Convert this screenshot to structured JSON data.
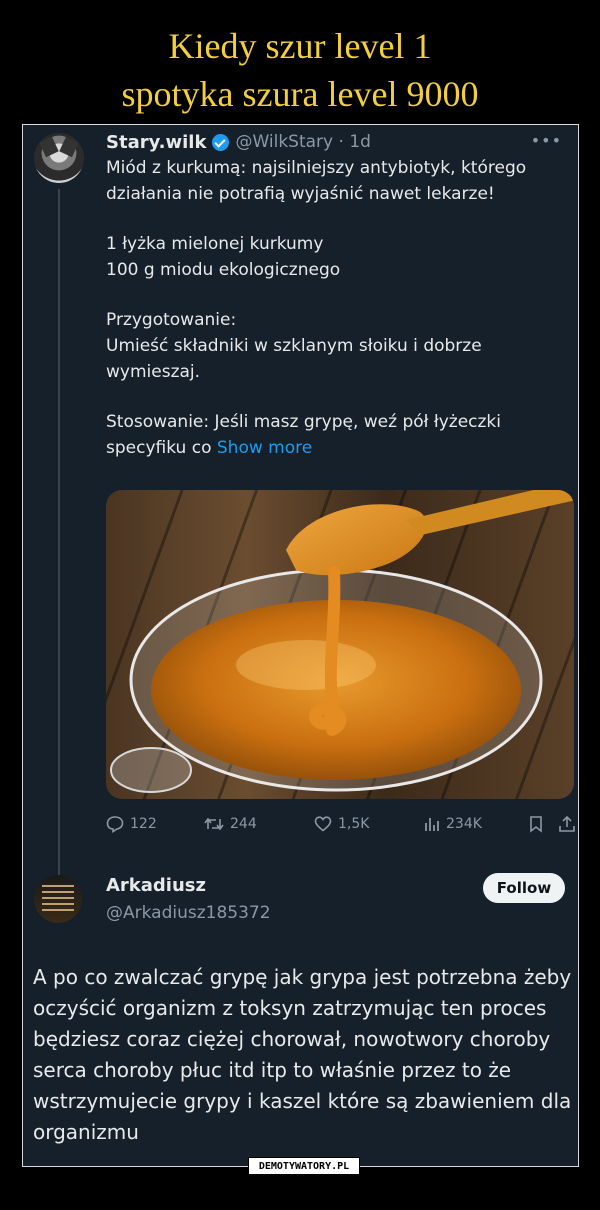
{
  "meme": {
    "title_line1": "Kiedy szur level 1",
    "title_line2": "spotyka szura level 9000",
    "watermark": "DEMOTYWATORY.PL"
  },
  "tweet": {
    "author_name": "Stary.wilk",
    "handle_time": "@WilkStary · 1d",
    "more_icon": "more-dots-icon",
    "paragraphs": [
      "Miód z kurkumą: najsilniejszy antybiotyk, którego działania nie potrafią wyjaśnić nawet lekarze!",
      "1 łyżka mielonej kurkumy\n100 g miodu ekologicznego",
      "Przygotowanie:\nUmieść składniki w szklanym słoiku i dobrze wymieszaj."
    ],
    "last_paragraph": "Stosowanie: Jeśli masz grypę, weź pół łyżeczki specyfiku co ",
    "show_more": "Show more",
    "stats": {
      "replies": "122",
      "reposts": "244",
      "likes": "1,5K",
      "views": "234K"
    }
  },
  "reply": {
    "author_name": "Arkadiusz",
    "handle": "@Arkadiusz185372",
    "follow_label": "Follow",
    "text": "A po co zwalczać grypę jak grypa jest potrzebna żeby oczyścić organizm z toksyn zatrzymując ten proces będziesz coraz ciężej chorował, nowotwory choroby serca choroby płuc itd itp to właśnie przez to że wstrzymujecie grypy i kaszel które są zbawieniem dla organizmu"
  },
  "colors": {
    "title": "#f2cf3c",
    "background": "#15202b",
    "link": "#1d9bf0",
    "muted": "#8b98a5"
  }
}
